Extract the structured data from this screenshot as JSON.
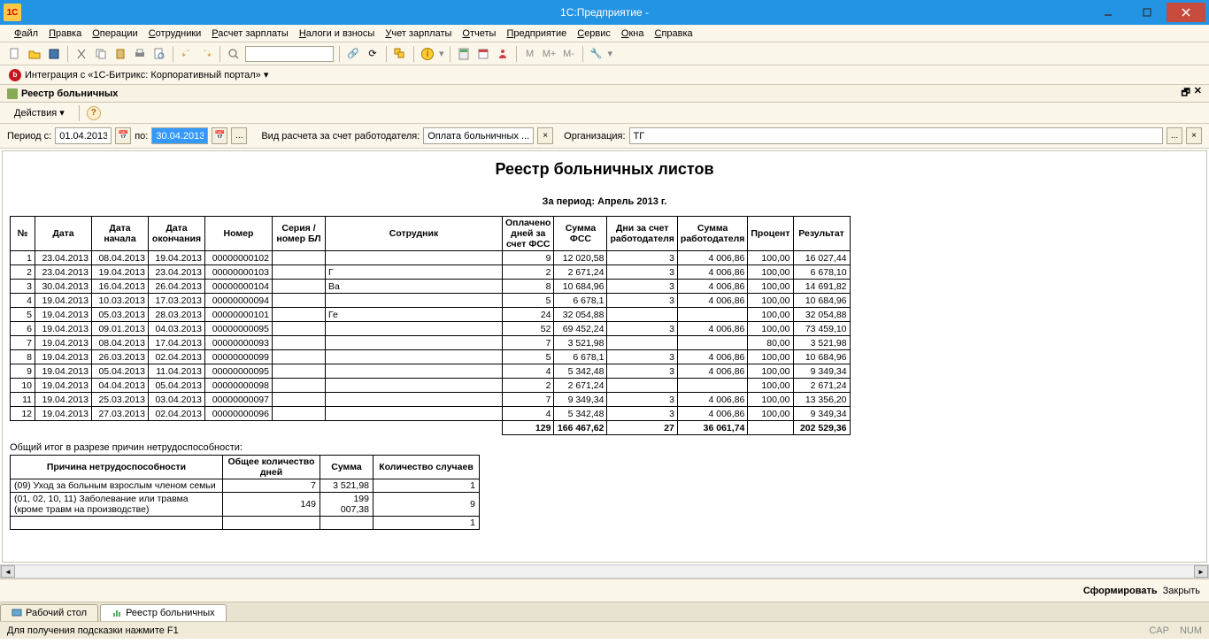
{
  "window": {
    "title": "1С:Предприятие -",
    "logo": "1C"
  },
  "menu": [
    "Файл",
    "Правка",
    "Операции",
    "Сотрудники",
    "Расчет зарплаты",
    "Налоги и взносы",
    "Учет зарплаты",
    "Отчеты",
    "Предприятие",
    "Сервис",
    "Окна",
    "Справка"
  ],
  "bitrix": {
    "text": "Интеграция с «1С-Битрикс: Корпоративный портал» ▾"
  },
  "doc_tab": {
    "title": "Реестр больничных"
  },
  "actions": {
    "label": "Действия ▾"
  },
  "filter": {
    "period_from_label": "Период с:",
    "from": "01.04.2013",
    "to_label": "по:",
    "to": "30.04.2013",
    "calc_label": "Вид расчета за счет работодателя:",
    "calc_value": "Оплата больничных ...",
    "org_label": "Организация:",
    "org_value": "ТГ"
  },
  "report": {
    "title": "Реестр больничных листов",
    "sub1": "————————————————————",
    "sub2": "За период: Апрель 2013 г.",
    "headers": [
      "№",
      "Дата",
      "Дата начала",
      "Дата окончания",
      "Номер",
      "Серия / номер БЛ",
      "Сотрудник",
      "Оплачено дней за счет ФСС",
      "Сумма ФСС",
      "Дни за счет работодателя",
      "Сумма работодателя",
      "Процент",
      "Результат"
    ],
    "rows": [
      [
        "1",
        "23.04.2013",
        "08.04.2013",
        "19.04.2013",
        "00000000102",
        "",
        "",
        "9",
        "12 020,58",
        "3",
        "4 006,86",
        "100,00",
        "16 027,44"
      ],
      [
        "2",
        "23.04.2013",
        "19.04.2013",
        "23.04.2013",
        "00000000103",
        "",
        "Г",
        "2",
        "2 671,24",
        "3",
        "4 006,86",
        "100,00",
        "6 678,10"
      ],
      [
        "3",
        "30.04.2013",
        "16.04.2013",
        "26.04.2013",
        "00000000104",
        "",
        "Ва",
        "8",
        "10 684,96",
        "3",
        "4 006,86",
        "100,00",
        "14 691,82"
      ],
      [
        "4",
        "19.04.2013",
        "10.03.2013",
        "17.03.2013",
        "00000000094",
        "",
        "",
        "5",
        "6 678,1",
        "3",
        "4 006,86",
        "100,00",
        "10 684,96"
      ],
      [
        "5",
        "19.04.2013",
        "05.03.2013",
        "28.03.2013",
        "00000000101",
        "",
        "Ге",
        "24",
        "32 054,88",
        "",
        "",
        "100,00",
        "32 054,88"
      ],
      [
        "6",
        "19.04.2013",
        "09.01.2013",
        "04.03.2013",
        "00000000095",
        "",
        "",
        "52",
        "69 452,24",
        "3",
        "4 006,86",
        "100,00",
        "73 459,10"
      ],
      [
        "7",
        "19.04.2013",
        "08.04.2013",
        "17.04.2013",
        "00000000093",
        "",
        "",
        "7",
        "3 521,98",
        "",
        "",
        "80,00",
        "3 521,98"
      ],
      [
        "8",
        "19.04.2013",
        "26.03.2013",
        "02.04.2013",
        "00000000099",
        "",
        "",
        "5",
        "6 678,1",
        "3",
        "4 006,86",
        "100,00",
        "10 684,96"
      ],
      [
        "9",
        "19.04.2013",
        "05.04.2013",
        "11.04.2013",
        "00000000095",
        "",
        "",
        "4",
        "5 342,48",
        "3",
        "4 006,86",
        "100,00",
        "9 349,34"
      ],
      [
        "10",
        "19.04.2013",
        "04.04.2013",
        "05.04.2013",
        "00000000098",
        "",
        "",
        "2",
        "2 671,24",
        "",
        "",
        "100,00",
        "2 671,24"
      ],
      [
        "11",
        "19.04.2013",
        "25.03.2013",
        "03.04.2013",
        "00000000097",
        "",
        "",
        "7",
        "9 349,34",
        "3",
        "4 006,86",
        "100,00",
        "13 356,20"
      ],
      [
        "12",
        "19.04.2013",
        "27.03.2013",
        "02.04.2013",
        "00000000096",
        "",
        "",
        "4",
        "5 342,48",
        "3",
        "4 006,86",
        "100,00",
        "9 349,34"
      ]
    ],
    "totals": [
      "",
      "",
      "",
      "",
      "",
      "",
      "",
      "129",
      "166 467,62",
      "27",
      "36 061,74",
      "",
      "202 529,36"
    ]
  },
  "summary": {
    "label": "Общий итог в разрезе причин нетрудоспособности:",
    "headers": [
      "Причина нетрудоспособности",
      "Общее количество дней",
      "Сумма",
      "Количество случаев"
    ],
    "rows": [
      [
        "(09) Уход за больным взрослым членом семьи",
        "7",
        "3 521,98",
        "1"
      ],
      [
        "(01, 02, 10, 11) Заболевание или травма (кроме травм на производстве)",
        "149",
        "199 007,38",
        "9"
      ],
      [
        "",
        "",
        "",
        "1"
      ]
    ]
  },
  "footer": {
    "form": "Сформировать",
    "close": "Закрыть"
  },
  "tabs": {
    "desktop": "Рабочий стол",
    "registry": "Реестр больничных"
  },
  "status": {
    "hint": "Для получения подсказки нажмите F1",
    "cap": "CAP",
    "num": "NUM"
  }
}
